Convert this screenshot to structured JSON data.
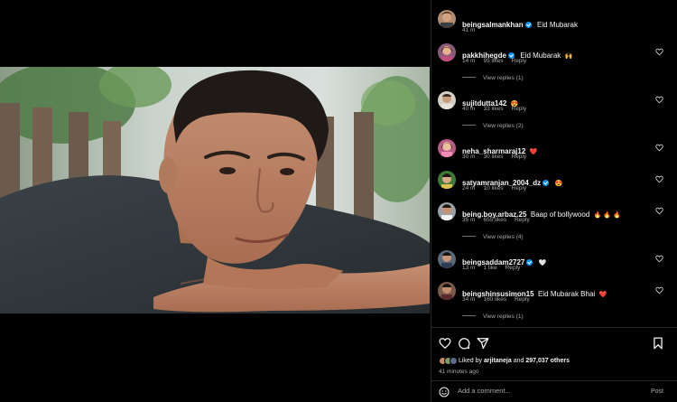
{
  "post": {
    "author": "beingsalmankhan",
    "caption": "Eid Mubarak",
    "time": "41 m"
  },
  "comments": [
    {
      "user": "pakkhihegde",
      "verified": true,
      "text": "Eid Mubarak",
      "emoji": "🙌",
      "time": "14 m",
      "likes": "95 likes",
      "reply": "Reply",
      "view_replies": "View replies (1)"
    },
    {
      "user": "sujitdutta142",
      "verified": false,
      "text": "",
      "emoji": "😍",
      "time": "40 m",
      "likes": "33 likes",
      "reply": "Reply",
      "view_replies": "View replies (2)"
    },
    {
      "user": "neha_sharmaraj12",
      "verified": false,
      "text": "",
      "emoji": "❤️",
      "time": "30 m",
      "likes": "30 likes",
      "reply": "Reply",
      "view_replies": ""
    },
    {
      "user": "satyamranjan_2004_dz",
      "verified": true,
      "text": "",
      "emoji": "😍",
      "time": "24 m",
      "likes": "10 likes",
      "reply": "Reply",
      "view_replies": ""
    },
    {
      "user": "being.boy.arbaz.25",
      "verified": false,
      "text": "Baap of bollywood",
      "emoji": "🔥 🔥 🔥",
      "time": "35 m",
      "likes": "655 likes",
      "reply": "Reply",
      "view_replies": "View replies (4)"
    },
    {
      "user": "beingsaddam2727",
      "verified": true,
      "text": "",
      "emoji": "🤍",
      "time": "13 m",
      "likes": "1 like",
      "reply": "Reply",
      "view_replies": ""
    },
    {
      "user": "beingshinsusimon15",
      "verified": false,
      "text": "Eid Mubarak Bhai",
      "emoji": "❤️",
      "time": "34 m",
      "likes": "160 likes",
      "reply": "Reply",
      "view_replies": "View replies (1)"
    }
  ],
  "likes_summary": {
    "prefix": "Liked by",
    "user": "arjitaneja",
    "middle": "and",
    "count": "297,037 others"
  },
  "time_ago": "41 minutes ago",
  "add_comment": {
    "placeholder": "Add a comment...",
    "post_label": "Post"
  },
  "colors": {
    "background": "#000000",
    "text": "#f5f5f5",
    "muted": "#a8a8a8",
    "verified": "#0095f6",
    "divider": "#262626"
  },
  "icons": [
    "heart-icon",
    "comment-icon",
    "share-icon",
    "bookmark-icon",
    "smiley-icon",
    "verified-icon"
  ]
}
